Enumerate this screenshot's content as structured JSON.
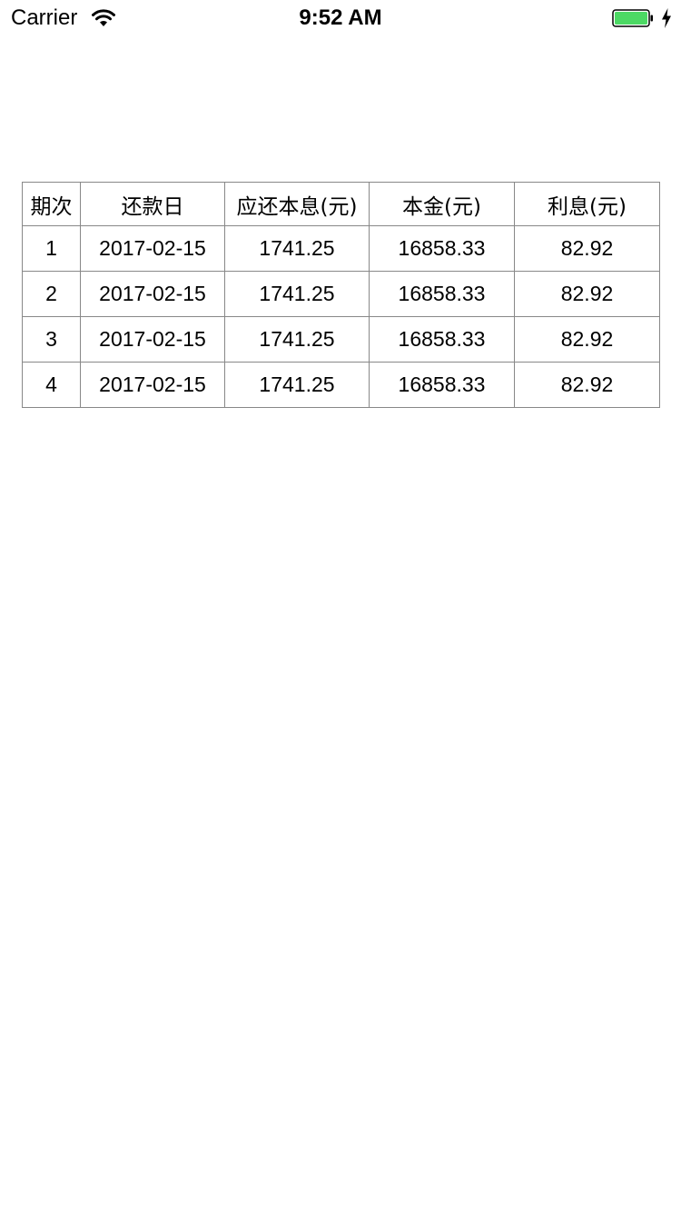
{
  "status_bar": {
    "carrier": "Carrier",
    "time": "9:52 AM",
    "battery_color": "#4cd964",
    "icons": [
      "wifi-icon",
      "battery-icon",
      "charging-bolt-icon"
    ]
  },
  "table": {
    "headers": [
      "期次",
      "还款日",
      "应还本息(元)",
      "本金(元)",
      "利息(元)"
    ],
    "rows": [
      [
        "1",
        "2017-02-15",
        "1741.25",
        "16858.33",
        "82.92"
      ],
      [
        "2",
        "2017-02-15",
        "1741.25",
        "16858.33",
        "82.92"
      ],
      [
        "3",
        "2017-02-15",
        "1741.25",
        "16858.33",
        "82.92"
      ],
      [
        "4",
        "2017-02-15",
        "1741.25",
        "16858.33",
        "82.92"
      ]
    ],
    "border_color": "#888888"
  }
}
